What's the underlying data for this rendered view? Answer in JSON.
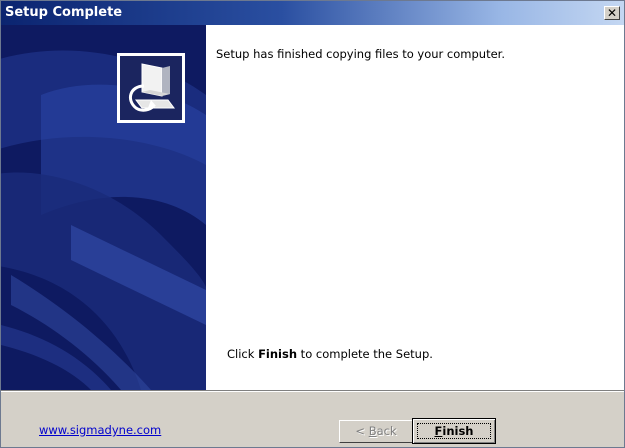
{
  "window": {
    "title": "Setup Complete",
    "close_glyph": "✕"
  },
  "content": {
    "message": "Setup has finished copying files to your computer.",
    "finish_prefix": "Click ",
    "finish_bold": "Finish",
    "finish_suffix": " to complete the Setup."
  },
  "footer": {
    "link_text": "www.sigmadyne.com",
    "back_prefix": "< ",
    "back_mnemonic": "B",
    "back_rest": "ack",
    "finish_mnemonic": "F",
    "finish_rest": "inish"
  },
  "icons": {
    "banner": "setup-banner-graphic",
    "computer": "computer-setup-icon",
    "close": "close-icon"
  },
  "colors": {
    "titlebar_start": "#0b2470",
    "titlebar_end": "#c4d7f2",
    "banner": "#0e1a61",
    "link": "#0000cc"
  }
}
